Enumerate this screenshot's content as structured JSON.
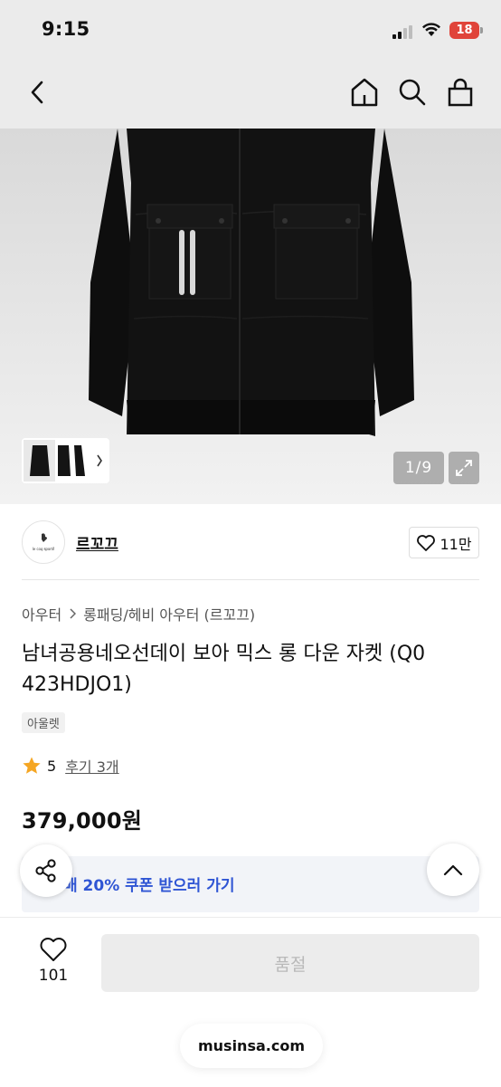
{
  "status_bar": {
    "time": "9:15",
    "battery": "18"
  },
  "header": {
    "back_icon": "chevron-left-icon",
    "home_icon": "home-icon",
    "search_icon": "search-icon",
    "cart_icon": "shopping-bag-icon"
  },
  "gallery": {
    "counter": "1/9"
  },
  "brand": {
    "name": "르꼬끄",
    "logo_text": "le coq sportif",
    "likes": "11만"
  },
  "breadcrumb": [
    "아우터",
    "롱패딩/헤비 아우터 (르꼬끄)"
  ],
  "product": {
    "title_line1": "남녀공용네오선데이 보아 믹스 롱 다운 자켓 (Q0",
    "title_line2": "423HDJO1)",
    "badge": "아울렛",
    "rating": "5",
    "reviews": "후기 3개",
    "price": "379,000원"
  },
  "coupon": {
    "text": "매 20% 쿠폰 받으러 가기"
  },
  "bottom": {
    "wish_count": "101",
    "buy_label": "품절"
  },
  "browser": {
    "url": "musinsa.com"
  },
  "colors": {
    "accent": "#2f55d4",
    "star": "#f5a623"
  }
}
